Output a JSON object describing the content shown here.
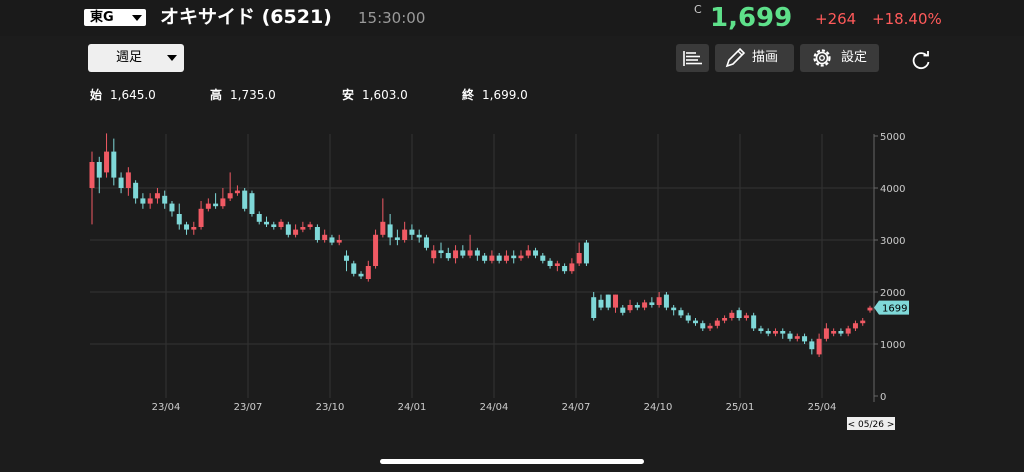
{
  "header": {
    "market": "東G",
    "title": "オキサイド (6521)",
    "time": "15:30:00",
    "price_marker": "C",
    "price": "1,699",
    "change": "+264",
    "change_pct": "+18.40%"
  },
  "toolbar": {
    "period": "週足",
    "draw_label": "描画",
    "settings_label": "設定",
    "icons": [
      "bars-icon",
      "pencil-icon",
      "gear-icon",
      "reload-icon"
    ]
  },
  "ohlc": {
    "open_label": "始",
    "open": "1,645.0",
    "high_label": "高",
    "high": "1,735.0",
    "low_label": "安",
    "low": "1,603.0",
    "close_label": "終",
    "close": "1,699.0"
  },
  "colors": {
    "up": "#f05a64",
    "down": "#7fd8d8",
    "price_up": "#5ee08a",
    "change": "#ff5a5a"
  },
  "chart_data": {
    "type": "candlestick",
    "y_ticks": [
      "5000",
      "4000",
      "3000",
      "2000",
      "1000",
      "0"
    ],
    "ylim": [
      0,
      5000
    ],
    "x_ticks": [
      "23/04",
      "23/07",
      "23/10",
      "24/01",
      "24/04",
      "24/07",
      "24/10",
      "25/01",
      "25/04"
    ],
    "current_label": "1699",
    "date_badge": "< 05/26 >",
    "grid": true,
    "candles": [
      {
        "o": 4000,
        "c": 4500,
        "h": 4700,
        "l": 3300
      },
      {
        "o": 4500,
        "c": 4200,
        "h": 4600,
        "l": 3900
      },
      {
        "o": 4300,
        "c": 4700,
        "h": 5050,
        "l": 4200
      },
      {
        "o": 4700,
        "c": 4200,
        "h": 4950,
        "l": 4050
      },
      {
        "o": 4200,
        "c": 4000,
        "h": 4300,
        "l": 3900
      },
      {
        "o": 4000,
        "c": 4300,
        "h": 4400,
        "l": 3850
      },
      {
        "o": 4100,
        "c": 3800,
        "h": 4150,
        "l": 3700
      },
      {
        "o": 3800,
        "c": 3700,
        "h": 3900,
        "l": 3600
      },
      {
        "o": 3700,
        "c": 3800,
        "h": 3900,
        "l": 3600
      },
      {
        "o": 3800,
        "c": 3900,
        "h": 4000,
        "l": 3700
      },
      {
        "o": 3850,
        "c": 3700,
        "h": 3950,
        "l": 3600
      },
      {
        "o": 3700,
        "c": 3550,
        "h": 3750,
        "l": 3450
      },
      {
        "o": 3500,
        "c": 3300,
        "h": 3700,
        "l": 3200
      },
      {
        "o": 3300,
        "c": 3200,
        "h": 3350,
        "l": 3100
      },
      {
        "o": 3200,
        "c": 3250,
        "h": 3350,
        "l": 3100
      },
      {
        "o": 3250,
        "c": 3600,
        "h": 3750,
        "l": 3200
      },
      {
        "o": 3600,
        "c": 3700,
        "h": 3800,
        "l": 3550
      },
      {
        "o": 3700,
        "c": 3650,
        "h": 3900,
        "l": 3600
      },
      {
        "o": 3650,
        "c": 3800,
        "h": 4000,
        "l": 3600
      },
      {
        "o": 3800,
        "c": 3900,
        "h": 4300,
        "l": 3750
      },
      {
        "o": 3900,
        "c": 3950,
        "h": 4050,
        "l": 3850
      },
      {
        "o": 3950,
        "c": 3600,
        "h": 4000,
        "l": 3550
      },
      {
        "o": 3900,
        "c": 3500,
        "h": 3950,
        "l": 3450
      },
      {
        "o": 3500,
        "c": 3350,
        "h": 3550,
        "l": 3300
      },
      {
        "o": 3350,
        "c": 3300,
        "h": 3450,
        "l": 3250
      },
      {
        "o": 3300,
        "c": 3250,
        "h": 3350,
        "l": 3200
      },
      {
        "o": 3250,
        "c": 3350,
        "h": 3400,
        "l": 3200
      },
      {
        "o": 3300,
        "c": 3100,
        "h": 3350,
        "l": 3050
      },
      {
        "o": 3100,
        "c": 3200,
        "h": 3300,
        "l": 3050
      },
      {
        "o": 3200,
        "c": 3250,
        "h": 3350,
        "l": 3150
      },
      {
        "o": 3250,
        "c": 3300,
        "h": 3350,
        "l": 3200
      },
      {
        "o": 3250,
        "c": 3000,
        "h": 3300,
        "l": 2950
      },
      {
        "o": 3000,
        "c": 3100,
        "h": 3200,
        "l": 2950
      },
      {
        "o": 3050,
        "c": 2950,
        "h": 3100,
        "l": 2900
      },
      {
        "o": 2950,
        "c": 3000,
        "h": 3100,
        "l": 2900
      },
      {
        "o": 2700,
        "c": 2600,
        "h": 2800,
        "l": 2400
      },
      {
        "o": 2550,
        "c": 2350,
        "h": 2600,
        "l": 2300
      },
      {
        "o": 2350,
        "c": 2300,
        "h": 2400,
        "l": 2250
      },
      {
        "o": 2250,
        "c": 2500,
        "h": 2600,
        "l": 2200
      },
      {
        "o": 2500,
        "c": 3100,
        "h": 3200,
        "l": 2450
      },
      {
        "o": 3100,
        "c": 3350,
        "h": 3800,
        "l": 3050
      },
      {
        "o": 3300,
        "c": 3050,
        "h": 3500,
        "l": 2900
      },
      {
        "o": 3050,
        "c": 3000,
        "h": 3200,
        "l": 2900
      },
      {
        "o": 3000,
        "c": 3200,
        "h": 3350,
        "l": 2950
      },
      {
        "o": 3200,
        "c": 3100,
        "h": 3300,
        "l": 3000
      },
      {
        "o": 3100,
        "c": 3050,
        "h": 3200,
        "l": 2950
      },
      {
        "o": 3050,
        "c": 2850,
        "h": 3100,
        "l": 2800
      },
      {
        "o": 2650,
        "c": 2800,
        "h": 2900,
        "l": 2550
      },
      {
        "o": 2800,
        "c": 2750,
        "h": 2950,
        "l": 2650
      },
      {
        "o": 2750,
        "c": 2650,
        "h": 2850,
        "l": 2600
      },
      {
        "o": 2650,
        "c": 2800,
        "h": 2900,
        "l": 2550
      },
      {
        "o": 2800,
        "c": 2700,
        "h": 2900,
        "l": 2650
      },
      {
        "o": 2700,
        "c": 2800,
        "h": 3100,
        "l": 2650
      },
      {
        "o": 2800,
        "c": 2700,
        "h": 2850,
        "l": 2600
      },
      {
        "o": 2700,
        "c": 2600,
        "h": 2750,
        "l": 2550
      },
      {
        "o": 2600,
        "c": 2700,
        "h": 2800,
        "l": 2550
      },
      {
        "o": 2700,
        "c": 2600,
        "h": 2750,
        "l": 2550
      },
      {
        "o": 2600,
        "c": 2700,
        "h": 2800,
        "l": 2550
      },
      {
        "o": 2700,
        "c": 2650,
        "h": 2800,
        "l": 2550
      },
      {
        "o": 2650,
        "c": 2700,
        "h": 2800,
        "l": 2600
      },
      {
        "o": 2700,
        "c": 2800,
        "h": 2900,
        "l": 2650
      },
      {
        "o": 2800,
        "c": 2700,
        "h": 2850,
        "l": 2650
      },
      {
        "o": 2700,
        "c": 2600,
        "h": 2750,
        "l": 2550
      },
      {
        "o": 2600,
        "c": 2500,
        "h": 2650,
        "l": 2450
      },
      {
        "o": 2500,
        "c": 2550,
        "h": 2600,
        "l": 2400
      },
      {
        "o": 2500,
        "c": 2400,
        "h": 2550,
        "l": 2350
      },
      {
        "o": 2400,
        "c": 2550,
        "h": 2650,
        "l": 2350
      },
      {
        "o": 2550,
        "c": 2750,
        "h": 2950,
        "l": 2500
      },
      {
        "o": 2950,
        "c": 2550,
        "h": 3000,
        "l": 2500
      },
      {
        "o": 1900,
        "c": 1500,
        "h": 2000,
        "l": 1450
      },
      {
        "o": 1850,
        "c": 1700,
        "h": 1950,
        "l": 1650
      },
      {
        "o": 1950,
        "c": 1700,
        "h": 1950,
        "l": 1650
      },
      {
        "o": 1700,
        "c": 1950,
        "h": 1950,
        "l": 1600
      },
      {
        "o": 1700,
        "c": 1600,
        "h": 1750,
        "l": 1550
      },
      {
        "o": 1650,
        "c": 1750,
        "h": 1850,
        "l": 1600
      },
      {
        "o": 1750,
        "c": 1700,
        "h": 1800,
        "l": 1650
      },
      {
        "o": 1700,
        "c": 1800,
        "h": 1850,
        "l": 1650
      },
      {
        "o": 1800,
        "c": 1750,
        "h": 1900,
        "l": 1700
      },
      {
        "o": 1750,
        "c": 1900,
        "h": 2000,
        "l": 1700
      },
      {
        "o": 1950,
        "c": 1700,
        "h": 2000,
        "l": 1650
      },
      {
        "o": 1700,
        "c": 1650,
        "h": 1750,
        "l": 1550
      },
      {
        "o": 1650,
        "c": 1550,
        "h": 1700,
        "l": 1500
      },
      {
        "o": 1550,
        "c": 1450,
        "h": 1600,
        "l": 1400
      },
      {
        "o": 1450,
        "c": 1400,
        "h": 1500,
        "l": 1350
      },
      {
        "o": 1400,
        "c": 1300,
        "h": 1450,
        "l": 1250
      },
      {
        "o": 1300,
        "c": 1350,
        "h": 1400,
        "l": 1250
      },
      {
        "o": 1350,
        "c": 1450,
        "h": 1500,
        "l": 1300
      },
      {
        "o": 1450,
        "c": 1500,
        "h": 1550,
        "l": 1400
      },
      {
        "o": 1500,
        "c": 1600,
        "h": 1650,
        "l": 1450
      },
      {
        "o": 1650,
        "c": 1500,
        "h": 1700,
        "l": 1450
      },
      {
        "o": 1500,
        "c": 1550,
        "h": 1600,
        "l": 1450
      },
      {
        "o": 1550,
        "c": 1300,
        "h": 1600,
        "l": 1250
      },
      {
        "o": 1300,
        "c": 1250,
        "h": 1350,
        "l": 1200
      },
      {
        "o": 1250,
        "c": 1200,
        "h": 1300,
        "l": 1150
      },
      {
        "o": 1200,
        "c": 1250,
        "h": 1300,
        "l": 1150
      },
      {
        "o": 1250,
        "c": 1200,
        "h": 1300,
        "l": 1100
      },
      {
        "o": 1200,
        "c": 1100,
        "h": 1250,
        "l": 1050
      },
      {
        "o": 1100,
        "c": 1150,
        "h": 1200,
        "l": 1050
      },
      {
        "o": 1150,
        "c": 1050,
        "h": 1200,
        "l": 1000
      },
      {
        "o": 1050,
        "c": 900,
        "h": 1100,
        "l": 800
      },
      {
        "o": 800,
        "c": 1100,
        "h": 1200,
        "l": 750
      },
      {
        "o": 1100,
        "c": 1300,
        "h": 1400,
        "l": 1050
      },
      {
        "o": 1200,
        "c": 1250,
        "h": 1300,
        "l": 1150
      },
      {
        "o": 1250,
        "c": 1200,
        "h": 1300,
        "l": 1150
      },
      {
        "o": 1200,
        "c": 1300,
        "h": 1350,
        "l": 1150
      },
      {
        "o": 1300,
        "c": 1400,
        "h": 1450,
        "l": 1250
      },
      {
        "o": 1400,
        "c": 1450,
        "h": 1500,
        "l": 1350
      },
      {
        "o": 1645,
        "c": 1699,
        "h": 1735,
        "l": 1603
      }
    ]
  }
}
